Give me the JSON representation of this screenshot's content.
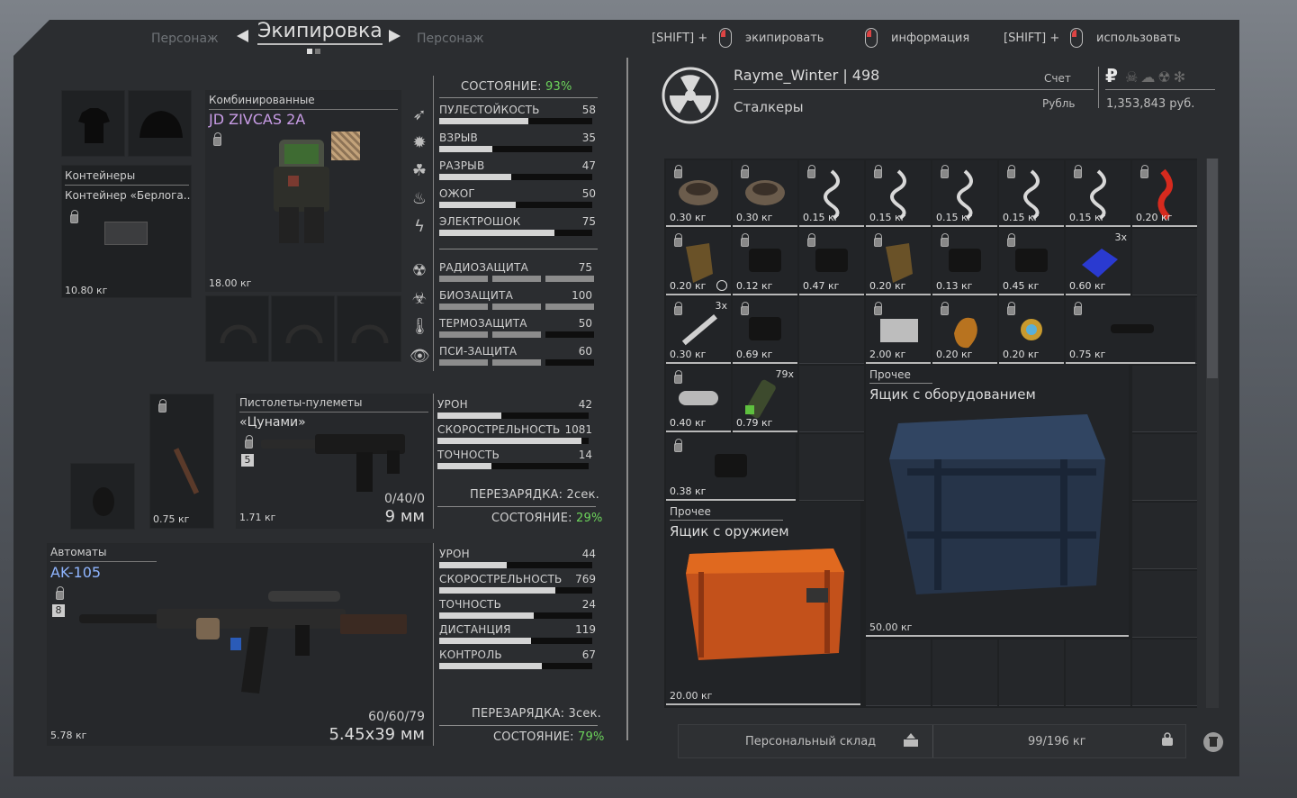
{
  "nav": {
    "prev_tab": "Персонаж",
    "current_tab": "Экипировка",
    "next_tab": "Персонаж",
    "hint1_prefix": "[SHIFT] +",
    "hint1_label": "экипировать",
    "hint2_label": "информация",
    "hint3_prefix": "[SHIFT] +",
    "hint3_label": "использовать"
  },
  "armor": {
    "category": "Комбинированные",
    "name": "JD ZIVCAS 2A",
    "weight": "18.00 кг",
    "condition_label": "СОСТОЯНИЕ:",
    "condition_value": "93%",
    "stats": [
      {
        "name": "ПУЛЕСТОЙКОСТЬ",
        "value": "58",
        "fill": 0.58
      },
      {
        "name": "ВЗРЫВ",
        "value": "35",
        "fill": 0.35
      },
      {
        "name": "РАЗРЫВ",
        "value": "47",
        "fill": 0.47
      },
      {
        "name": "ОЖОГ",
        "value": "50",
        "fill": 0.5
      },
      {
        "name": "ЭЛЕКТРОШОК",
        "value": "75",
        "fill": 0.75
      }
    ],
    "protection": [
      {
        "name": "РАДИОЗАЩИТА",
        "value": "75"
      },
      {
        "name": "БИОЗАЩИТА",
        "value": "100"
      },
      {
        "name": "ТЕРМОЗАЩИТА",
        "value": "50"
      },
      {
        "name": "ПСИ-ЗАЩИТА",
        "value": "60"
      }
    ]
  },
  "container": {
    "category": "Контейнеры",
    "name": "Контейнер «Берлога..",
    "weight": "10.80 кг"
  },
  "melee": {
    "weight": "0.75 кг"
  },
  "pistol": {
    "category": "Пистолеты-пулеметы",
    "name": "«Цунами»",
    "upgrade": "5",
    "weight": "1.71 кг",
    "ammo": "0/40/0",
    "caliber": "9 мм",
    "stats": [
      {
        "name": "УРОН",
        "value": "42",
        "fill": 0.42
      },
      {
        "name": "СКОРОСТРЕЛЬНОСТЬ",
        "value": "1081",
        "fill": 0.95
      },
      {
        "name": "ТОЧНОСТЬ",
        "value": "14",
        "fill": 0.36
      }
    ],
    "reload_label": "ПЕРЕЗАРЯДКА:",
    "reload_value": "2сек.",
    "condition_label": "СОСТОЯНИЕ:",
    "condition_value": "29%"
  },
  "rifle": {
    "category": "Автоматы",
    "name": "AK-105",
    "upgrade": "8",
    "weight": "5.78 кг",
    "ammo": "60/60/79",
    "caliber": "5.45х39 мм",
    "stats": [
      {
        "name": "УРОН",
        "value": "44",
        "fill": 0.44
      },
      {
        "name": "СКОРОСТРЕЛЬНОСТЬ",
        "value": "769",
        "fill": 0.76
      },
      {
        "name": "ТОЧНОСТЬ",
        "value": "24",
        "fill": 0.62
      },
      {
        "name": "ДИСТАНЦИЯ",
        "value": "119",
        "fill": 0.6
      },
      {
        "name": "КОНТРОЛЬ",
        "value": "67",
        "fill": 0.67
      }
    ],
    "reload_label": "ПЕРЕЗАРЯДКА:",
    "reload_value": "3сек.",
    "condition_label": "СОСТОЯНИЕ:",
    "condition_value": "79%"
  },
  "player": {
    "name": "Rayme_Winter",
    "separator": "|",
    "level": "498",
    "faction": "Сталкеры",
    "account_label": "Счет",
    "currency_label": "Рубль",
    "currency_symbol": "₽",
    "balance": "1,353,843 руб."
  },
  "inventory": {
    "cells": [
      {
        "w": "0.30 кг",
        "lock": true,
        "art": "nest"
      },
      {
        "w": "0.30 кг",
        "lock": true,
        "art": "nest"
      },
      {
        "w": "0.15 кг",
        "lock": true,
        "art": "spiral"
      },
      {
        "w": "0.15 кг",
        "lock": true,
        "art": "spiral"
      },
      {
        "w": "0.15 кг",
        "lock": true,
        "art": "spiral"
      },
      {
        "w": "0.15 кг",
        "lock": true,
        "art": "spiral"
      },
      {
        "w": "0.15 кг",
        "lock": true,
        "art": "spiral"
      },
      {
        "w": "0.20 кг",
        "lock": true,
        "art": "red"
      },
      {
        "w": "0.20 кг",
        "lock": true,
        "art": "brown",
        "clock": true
      },
      {
        "w": "0.12 кг",
        "lock": true,
        "art": "dark"
      },
      {
        "w": "0.47 кг",
        "lock": true,
        "art": "dark"
      },
      {
        "w": "0.20 кг",
        "lock": true,
        "art": "brown"
      },
      {
        "w": "0.13 кг",
        "lock": true,
        "art": "dark"
      },
      {
        "w": "0.45 кг",
        "lock": true,
        "art": "dark"
      },
      {
        "w": "0.60 кг",
        "lock": false,
        "art": "blue",
        "count": "3x"
      },
      {
        "w": "0.30 кг",
        "lock": true,
        "art": "syringe",
        "count": "3x"
      },
      {
        "w": "0.69 кг",
        "lock": true,
        "art": "dark"
      },
      {
        "w": "2.00 кг",
        "lock": true,
        "art": "plate"
      },
      {
        "w": "0.20 кг",
        "lock": true,
        "art": "orange"
      },
      {
        "w": "0.20 кг",
        "lock": true,
        "art": "star"
      },
      {
        "w": "0.75 кг",
        "lock": true,
        "art": "scope"
      },
      {
        "w": "0.40 кг",
        "lock": true,
        "art": "silencer"
      },
      {
        "w": "0.79 кг",
        "lock": false,
        "art": "green",
        "count": "79x"
      },
      {
        "w": "0.38 кг",
        "lock": true,
        "art": "dark"
      }
    ],
    "equip_box": {
      "category": "Прочее",
      "name": "Ящик с оборудованием",
      "weight": "50.00 кг"
    },
    "weapon_box": {
      "category": "Прочее",
      "name": "Ящик с оружием",
      "weight": "20.00 кг"
    }
  },
  "footer": {
    "storage_label": "Персональный склад",
    "weight_label": "99/196 кг"
  }
}
